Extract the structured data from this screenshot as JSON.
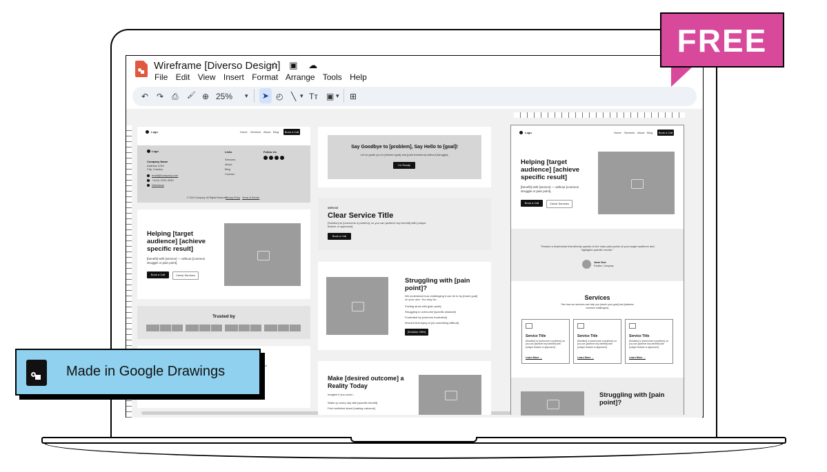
{
  "badge_free": "FREE",
  "made_in": "Made in Google Drawings",
  "window": {
    "title": "Wireframe [Diverso Design]",
    "title_icons": "☆ ▣ ☁",
    "menu": [
      "File",
      "Edit",
      "View",
      "Insert",
      "Format",
      "Arrange",
      "Tools",
      "Help"
    ]
  },
  "toolbar": {
    "undo": "↶",
    "redo": "↷",
    "print": "⎙",
    "paint": "🖌",
    "zoom_icon": "⊕",
    "zoom": "25%",
    "caret": "▾",
    "select": "➤",
    "shape": "◴",
    "line": "╲",
    "text": "Tт",
    "image": "▣",
    "add": "⊞"
  },
  "wf": {
    "logo": "Logo",
    "nav": [
      "Home",
      "Services",
      "About",
      "Blog"
    ],
    "book_call": "Book a Call",
    "footer": {
      "company": "Company Name",
      "address": [
        "Address 1234",
        "City, Country"
      ],
      "email": "email@company.com",
      "phone": "+1(11) 2222-3333",
      "directions": "Directions",
      "links_title": "Links",
      "links": [
        "Services",
        "About",
        "Blog",
        "Contact"
      ],
      "follow": "Follow Us",
      "copyright": "© 2024 Company. All Rights Reserved.",
      "privacy": "Privacy Policy",
      "terms": "Terms of Service"
    },
    "hero": {
      "title": "Helping [target audience] [achieve specific result]",
      "body": "[benefit] with [service] — without [common struggle or pain point].",
      "cta": "Book a Call",
      "secondary": "Check Services"
    },
    "trusted": "Trusted by",
    "goodbye": {
      "title": "Say Goodbye to [problem], Say Hello to [goal]!",
      "body": "Let us guide you to [desired goal] and [pain transform] without [struggle].",
      "cta": "I'm Ready"
    },
    "service": {
      "kicker": "SERVICE",
      "title": "Clear Service Title",
      "body": "[Solution] to [overcome a problem], so you can [achieve key benefit] with [unique feature or approach].",
      "cta": "Book a Call"
    },
    "struggle": {
      "title": "Struggling with [pain point]?",
      "body": "We understand how challenging it can be to try [reach goal] on your own. You may be...",
      "items": [
        "Feeling stuck with [pain point]",
        "Struggling to overcome [specific obstacle]",
        "Frustrated by [common frustration]",
        "Worried that trying to [do something difficult]"
      ],
      "cta": "[Solution Offer]"
    },
    "make": {
      "title": "Make [desired outcome] a Reality Today",
      "sub": "Imagine if you could...",
      "items": [
        "Wake up every day with [specific benefit]",
        "Feel confident about [making outcome]"
      ]
    },
    "testimonial": {
      "quote": "\"Feature a testimonial that directly speaks to the main pain points of your target audience and highlights specific results.\"",
      "name": "Jane Doe",
      "role": "Position, Company"
    },
    "services": {
      "title": "Services",
      "sub": "See how our services can help you [reach your goal] and [address common challenges].",
      "card_title": "Service Title",
      "card_body": "[Solution] to [overcome a problem], so you can [achieve key benefit] with [unique feature or approach].",
      "learn": "Learn More →"
    },
    "partial_text": "ts of"
  }
}
